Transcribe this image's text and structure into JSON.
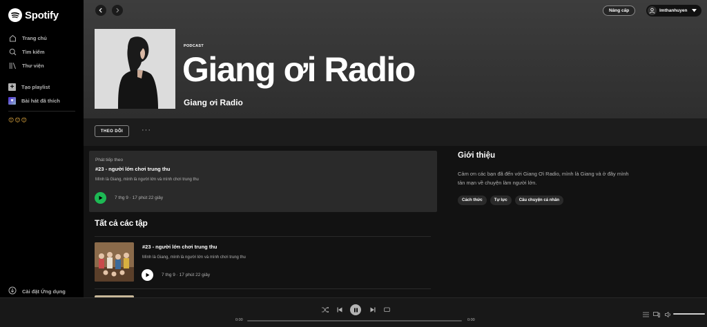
{
  "sidebar": {
    "logo_text": "Spotify",
    "nav": [
      {
        "label": "Trang chủ",
        "icon": "home-icon"
      },
      {
        "label": "Tìm kiếm",
        "icon": "search-icon"
      },
      {
        "label": "Thư viện",
        "icon": "library-icon"
      }
    ],
    "create_playlist": "Tạo playlist",
    "liked_songs": "Bài hát đã thích",
    "playlist_emoji": "😊😊😊",
    "install_app": "Cài đặt Ứng dụng"
  },
  "topbar": {
    "upgrade": "Nâng cấp",
    "username": "lmthanhuyen"
  },
  "hero": {
    "type": "PODCAST",
    "title": "Giang ơi Radio",
    "author": "Giang ơi Radio"
  },
  "actions": {
    "follow": "THEO DÕI",
    "more": "···"
  },
  "next_up": {
    "label": "Phát tiếp theo",
    "title": "#23 - người lớn chơi trung thu",
    "desc": "Mình là Giang, mình là người lớn và mình chơi trung thu",
    "meta": "7 thg 9 · 17 phút 22 giây"
  },
  "episodes_title": "Tất cả các tập",
  "episodes": [
    {
      "title": "#23 - người lớn chơi trung thu",
      "desc": "Mình là Giang, mình là người lớn và mình chơi trung thu",
      "meta": "7 thg 9 · 17 phút 22 giây"
    }
  ],
  "about": {
    "title": "Giới thiệu",
    "text": "Cảm ơn các bạn đã đến với Giang Ơi Radio, mình là Giang và ở đây mình tản mạn về chuyện làm người lớn.",
    "tags": [
      "Cách thức",
      "Tự lực",
      "Câu chuyện cá nhân"
    ]
  },
  "player": {
    "elapsed": "0:00",
    "duration": "0:00",
    "progress": 0,
    "volume": 1.0
  },
  "colors": {
    "accent": "#1db954",
    "background": "#121212",
    "hero": "#3d3d3d"
  }
}
